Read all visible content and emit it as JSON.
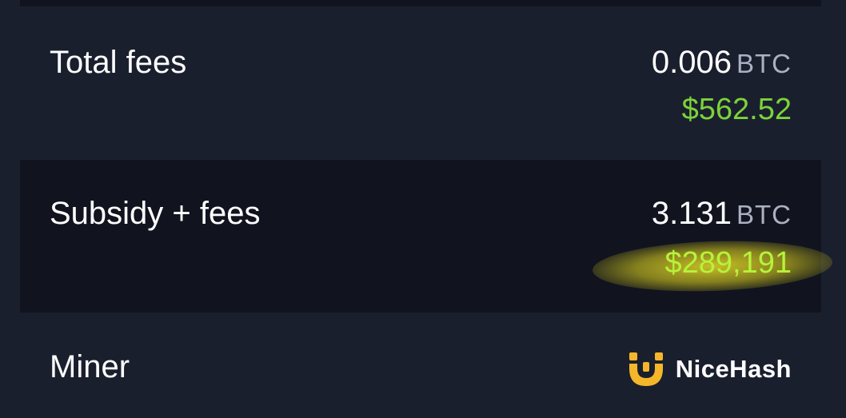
{
  "rows": {
    "total_fees": {
      "label": "Total fees",
      "btc_value": "0.006",
      "btc_unit": "BTC",
      "usd_value": "$562.52"
    },
    "subsidy_fees": {
      "label": "Subsidy + fees",
      "btc_value": "3.131",
      "btc_unit": "BTC",
      "usd_value": "$289,191"
    },
    "miner": {
      "label": "Miner",
      "name": "NiceHash",
      "logo_icon": "nicehash-logo-icon"
    }
  },
  "colors": {
    "background": "#1a1f2e",
    "alt_row": "#11141f",
    "usd_green": "#7cd33a",
    "highlight_yellow": "#e6dc28",
    "brand_orange": "#f5b72a"
  }
}
